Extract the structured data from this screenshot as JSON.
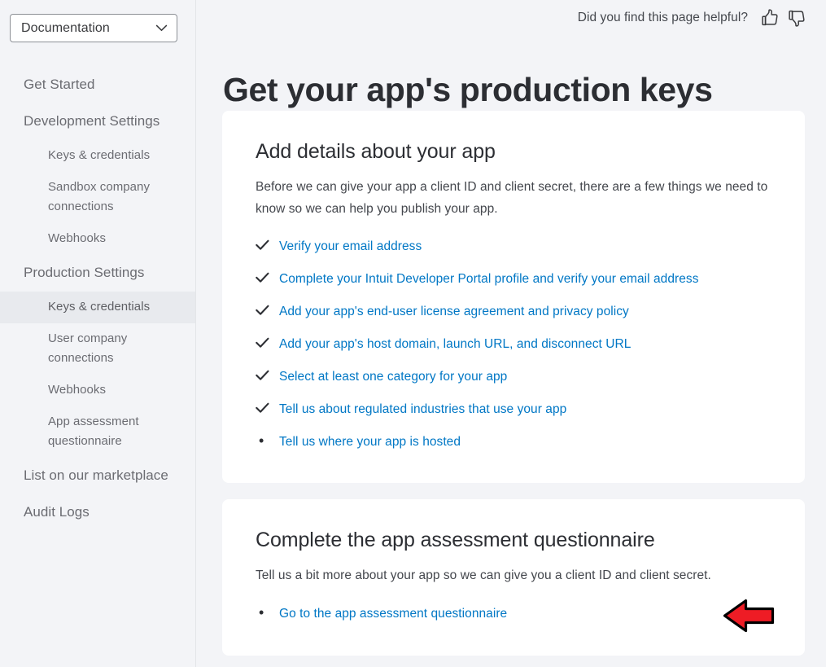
{
  "sidebar": {
    "selector": {
      "value": "Documentation",
      "icon": "chevron-down-icon"
    },
    "items": [
      {
        "label": "Get Started",
        "level": 1,
        "active": false
      },
      {
        "label": "Development Settings",
        "level": 1,
        "active": false
      },
      {
        "label": "Keys & credentials",
        "level": 2,
        "active": false
      },
      {
        "label": "Sandbox company connections",
        "level": 2,
        "active": false
      },
      {
        "label": "Webhooks",
        "level": 2,
        "active": false
      },
      {
        "label": "Production Settings",
        "level": 1,
        "active": false
      },
      {
        "label": "Keys & credentials",
        "level": 2,
        "active": true
      },
      {
        "label": "User company connections",
        "level": 2,
        "active": false
      },
      {
        "label": "Webhooks",
        "level": 2,
        "active": false
      },
      {
        "label": "App assessment questionnaire",
        "level": 2,
        "active": false
      },
      {
        "label": "List on our marketplace",
        "level": 1,
        "active": false
      },
      {
        "label": "Audit Logs",
        "level": 1,
        "active": false
      }
    ]
  },
  "header": {
    "feedback_label": "Did you find this page helpful?",
    "thumbs_up_icon": "thumbs-up-icon",
    "thumbs_down_icon": "thumbs-down-icon"
  },
  "page": {
    "title": "Get your app's production keys"
  },
  "cards": {
    "details": {
      "title": "Add details about your app",
      "description": "Before we can give your app a client ID and client secret, there are a few things we need to know so we can help you publish your app.",
      "items": [
        {
          "marker": "check",
          "label": "Verify your email address"
        },
        {
          "marker": "check",
          "label": "Complete your Intuit Developer Portal profile and verify your email address"
        },
        {
          "marker": "check",
          "label": "Add your app's end-user license agreement and privacy policy"
        },
        {
          "marker": "check",
          "label": "Add your app's host domain, launch URL, and disconnect URL"
        },
        {
          "marker": "check",
          "label": "Select at least one category for your app"
        },
        {
          "marker": "check",
          "label": "Tell us about regulated industries that use your app"
        },
        {
          "marker": "bullet",
          "label": "Tell us where your app is hosted"
        }
      ]
    },
    "questionnaire": {
      "title": "Complete the app assessment questionnaire",
      "description": "Tell us a bit more about your app so we can give you a client ID and client secret.",
      "items": [
        {
          "marker": "bullet",
          "label": "Go to the app assessment questionnaire"
        }
      ]
    }
  },
  "annotation": {
    "arrow": {
      "name": "red-left-arrow-annotation",
      "direction": "left",
      "fill_color": "#ee1c25",
      "stroke_color": "#000000"
    }
  },
  "colors": {
    "page_background": "#f3f4f7",
    "card_background": "#ffffff",
    "link_blue": "#0077c5",
    "text_dark": "#2c2e33",
    "text_body": "#44474d",
    "nav_text": "#6b6c72",
    "nav_active_background": "#e8eaee",
    "sidebar_border": "#e3e5e8"
  },
  "bullet_glyph": "•"
}
